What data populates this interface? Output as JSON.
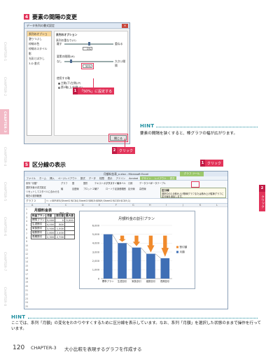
{
  "chapter_tabs": [
    {
      "label": "CHAPTER-1",
      "active": false
    },
    {
      "label": "CHAPTER-2",
      "active": false
    },
    {
      "label": "CHAPTER-3",
      "active": true
    },
    {
      "label": "CHAPTER-4",
      "active": false
    },
    {
      "label": "CHAPTER-5",
      "active": false
    },
    {
      "label": "CHAPTER-6",
      "active": false
    },
    {
      "label": "CHAPTER-7",
      "active": false
    },
    {
      "label": "CHAPTER-8",
      "active": false
    }
  ],
  "section4": {
    "number": "4",
    "title": "要素の間隔の変更"
  },
  "dialog": {
    "title": "データ系列の書式設定",
    "nav": [
      "系列のオプション",
      "塗りつぶし",
      "枠線の色",
      "枠線のスタイル",
      "影",
      "光彩とぼかし",
      "3-D 書式"
    ],
    "heading": "系列のオプション",
    "overlap_label": "系列の重なり(O)",
    "overlap_left": "離す",
    "overlap_right": "重ねる",
    "overlap_value": "0%",
    "gap_label": "要素の間隔(W)",
    "gap_left": "なし",
    "gap_right": "大きい間隔",
    "gap_value": "50%",
    "axis_label": "使用する軸",
    "axis_primary": "主軸(下/左側)(P)",
    "axis_secondary": "第2軸(上/右側)(S)",
    "close_button": "閉じる"
  },
  "callouts": {
    "c1_num": "1",
    "c1_text": "「50%」に設定する",
    "c2_num": "2",
    "c2_text": "クリック",
    "c3_num": "1",
    "c3_text": "クリック",
    "c4_num": "2",
    "c4_text": "クリック"
  },
  "hint1": {
    "label": "HINT",
    "text": "要素の間隔を狭くすると、棒グラフの幅が広がります。"
  },
  "section5": {
    "number": "5",
    "title": "区分線の表示"
  },
  "excel": {
    "title": "月額料金表_x.xlsx - Microsoft Excel",
    "context_tab": "グラフ ツール",
    "tabs": [
      "ファイル",
      "ホーム",
      "挿入",
      "ページレイアウト",
      "数式",
      "データ",
      "校閲",
      "表示",
      "アドイン",
      "Acrobat",
      "デザイン",
      "レイアウト",
      "書式"
    ],
    "ribbon_items": [
      "系列 \"月額\"",
      "選択対象の書式設定",
      "リセットしてスタイルに合わせる",
      "現在の選択範囲",
      "グラフ",
      "図",
      "図形",
      "テキストボックス",
      "グラフタイトル",
      "軸ラベル",
      "凡例",
      "データラベル",
      "データテーブル",
      "軸",
      "目盛線",
      "プロットエリア",
      "線",
      "ローソク足",
      "誤差範囲",
      "区分線",
      "高低線"
    ],
    "tooltip_title": "区分線",
    "tooltip_text": "選択中の2-D積み上げ横棒グラフまたは積み上げ縦棒グラフに区分線を追加します。",
    "name_box": "グラフ 2",
    "formula": "=SERIES(Sheet1!$C$4,Sheet1!$B$5:$B$9,Sheet1!$C$5:$C$9,1)",
    "columns": [
      "A",
      "B",
      "C",
      "D",
      "E",
      "F",
      "G",
      "H",
      "I",
      "J",
      "K",
      "L"
    ],
    "rows": [
      "1",
      "2",
      "3",
      "4",
      "5",
      "6",
      "7",
      "8",
      "9",
      "10",
      "11",
      "12",
      "13",
      "14",
      "15",
      "16",
      "17",
      "18",
      "19",
      "20",
      "21",
      "22",
      "23",
      "24",
      "25"
    ],
    "sheet_title": "月額料金表",
    "unit": "単位：円",
    "table_header": [
      "料金プラン",
      "月額",
      "割引額",
      "最大値"
    ],
    "table_rows": [
      [
        "標準プラン",
        "5,000",
        "0",
        "5,000"
      ],
      [
        "生涯割引",
        "4,000",
        "800",
        ""
      ],
      [
        "家族割引",
        "3,500",
        "1,500",
        ""
      ],
      [
        "複数割引",
        "2,800",
        "2,400",
        ""
      ],
      [
        "長期割引",
        "2,300",
        "2,700",
        ""
      ]
    ]
  },
  "chart_data": {
    "type": "bar",
    "title": "月額料金の割引プラン",
    "categories": [
      "標準プラン",
      "生涯割引",
      "家族割引",
      "複数割引",
      "長期割引"
    ],
    "series": [
      {
        "name": "割引額",
        "values": [
          0,
          800,
          1500,
          2400,
          2700
        ]
      },
      {
        "name": "月額",
        "values": [
          5000,
          4000,
          3500,
          2800,
          2300
        ]
      }
    ],
    "ylim": [
      0,
      6000
    ],
    "yticks": [
      "0",
      "1,000",
      "2,000",
      "3,000",
      "4,000",
      "5,000",
      "6,000"
    ],
    "colors": {
      "月額": "#3f6fb5",
      "割引額": "#f08a2c"
    },
    "legend": "right"
  },
  "hint2": {
    "label": "HINT",
    "text": "ここでは、系列「月額」の変化をわかりやすくするために区分線を表示しています。なお、系列「月額」を選択した状態のままで操作を行っています。"
  },
  "footer": {
    "page": "120",
    "chapter": "CHAPTER-3",
    "caption": "大小比較を表現するグラフを作成する"
  }
}
